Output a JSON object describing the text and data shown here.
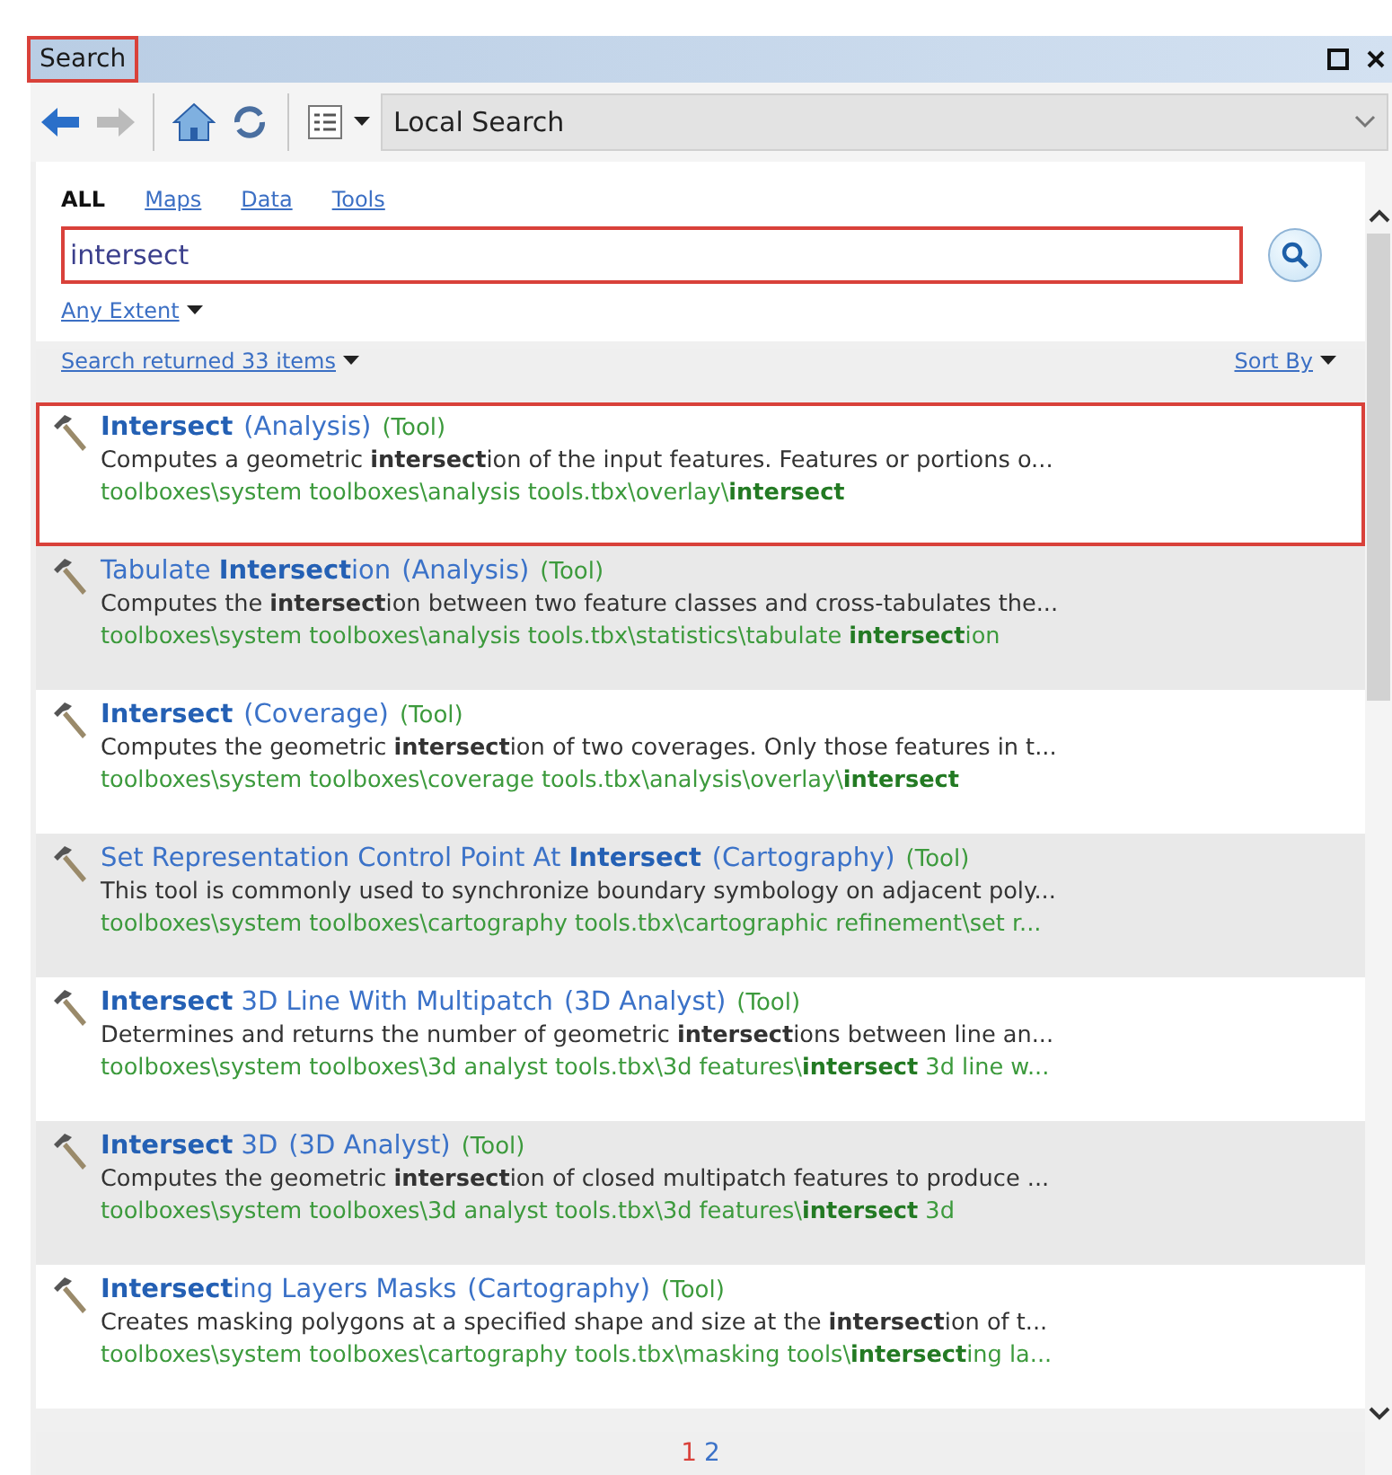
{
  "window": {
    "title": "Search",
    "title_highlighted": true
  },
  "toolbar": {
    "back_disabled": false,
    "forward_disabled": true,
    "scope": "Local Search"
  },
  "filters": [
    {
      "label": "ALL",
      "selected": true
    },
    {
      "label": "Maps",
      "selected": false
    },
    {
      "label": "Data",
      "selected": false
    },
    {
      "label": "Tools",
      "selected": false
    }
  ],
  "search": {
    "value": "intersect",
    "highlighted": true
  },
  "extent": "Any Extent",
  "results_header": {
    "summary": "Search returned 33 items",
    "sort": "Sort By"
  },
  "results": [
    {
      "name": "**Intersect**",
      "category": "(Analysis)",
      "type": "(Tool)",
      "description": "Computes a geometric **intersect**ion of the input features. Features or portions o...",
      "path": "toolboxes\\system toolboxes\\analysis tools.tbx\\overlay\\**intersect**",
      "highlighted": true
    },
    {
      "name": "Tabulate **Intersect**ion",
      "category": "(Analysis)",
      "type": "(Tool)",
      "description": "Computes the **intersect**ion between two feature classes and cross-tabulates the...",
      "path": "toolboxes\\system toolboxes\\analysis tools.tbx\\statistics\\tabulate **intersect**ion",
      "highlighted": false
    },
    {
      "name": "**Intersect**",
      "category": "(Coverage)",
      "type": "(Tool)",
      "description": "Computes the geometric **intersect**ion of two coverages. Only those features in t...",
      "path": "toolboxes\\system toolboxes\\coverage tools.tbx\\analysis\\overlay\\**intersect**",
      "highlighted": false
    },
    {
      "name": "Set Representation Control Point At **Intersect**",
      "category": "(Cartography)",
      "type": "(Tool)",
      "description": "This tool is commonly used to synchronize boundary symbology on adjacent poly...",
      "path": "toolboxes\\system toolboxes\\cartography tools.tbx\\cartographic refinement\\set r...",
      "highlighted": false
    },
    {
      "name": "**Intersect** 3D Line With Multipatch",
      "category": "(3D Analyst)",
      "type": "(Tool)",
      "description": "Determines and returns the number of geometric **intersect**ions between line an...",
      "path": "toolboxes\\system toolboxes\\3d analyst tools.tbx\\3d features\\**intersect** 3d line w...",
      "highlighted": false
    },
    {
      "name": "**Intersect** 3D",
      "category": "(3D Analyst)",
      "type": "(Tool)",
      "description": "Computes the geometric **intersect**ion of closed multipatch features to produce ...",
      "path": "toolboxes\\system toolboxes\\3d analyst tools.tbx\\3d features\\**intersect** 3d",
      "highlighted": false
    },
    {
      "name": "**Intersect**ing Layers Masks",
      "category": "(Cartography)",
      "type": "(Tool)",
      "description": "Creates masking polygons at a specified shape and size at the **intersect**ion of t...",
      "path": "toolboxes\\system toolboxes\\cartography tools.tbx\\masking tools\\**intersect**ing la...",
      "highlighted": false
    }
  ],
  "pages": [
    {
      "label": "1",
      "selected": true
    },
    {
      "label": "2",
      "selected": false
    }
  ]
}
